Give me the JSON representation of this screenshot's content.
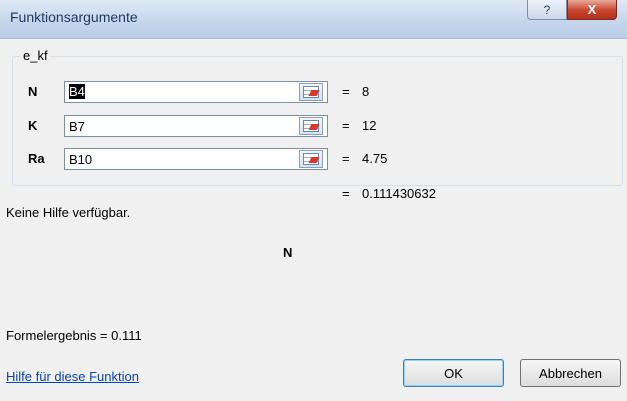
{
  "window": {
    "title": "Funktionsargumente",
    "help_label": "?",
    "close_label": "X"
  },
  "function_name": "e_kf",
  "arguments": [
    {
      "label": "N",
      "value": "B4",
      "result": "8"
    },
    {
      "label": "K",
      "value": "B7",
      "result": "12"
    },
    {
      "label": "Ra",
      "value": "B10",
      "result": "4.75"
    }
  ],
  "equals": "=",
  "function_result": "0.111430632",
  "description": "Keine Hilfe verfügbar.",
  "current_argument": "N",
  "formula_result_label": "Formelergebnis =",
  "formula_result_value": "0.111",
  "help_link": "Hilfe für diese Funktion",
  "buttons": {
    "ok": "OK",
    "cancel": "Abbrechen"
  }
}
